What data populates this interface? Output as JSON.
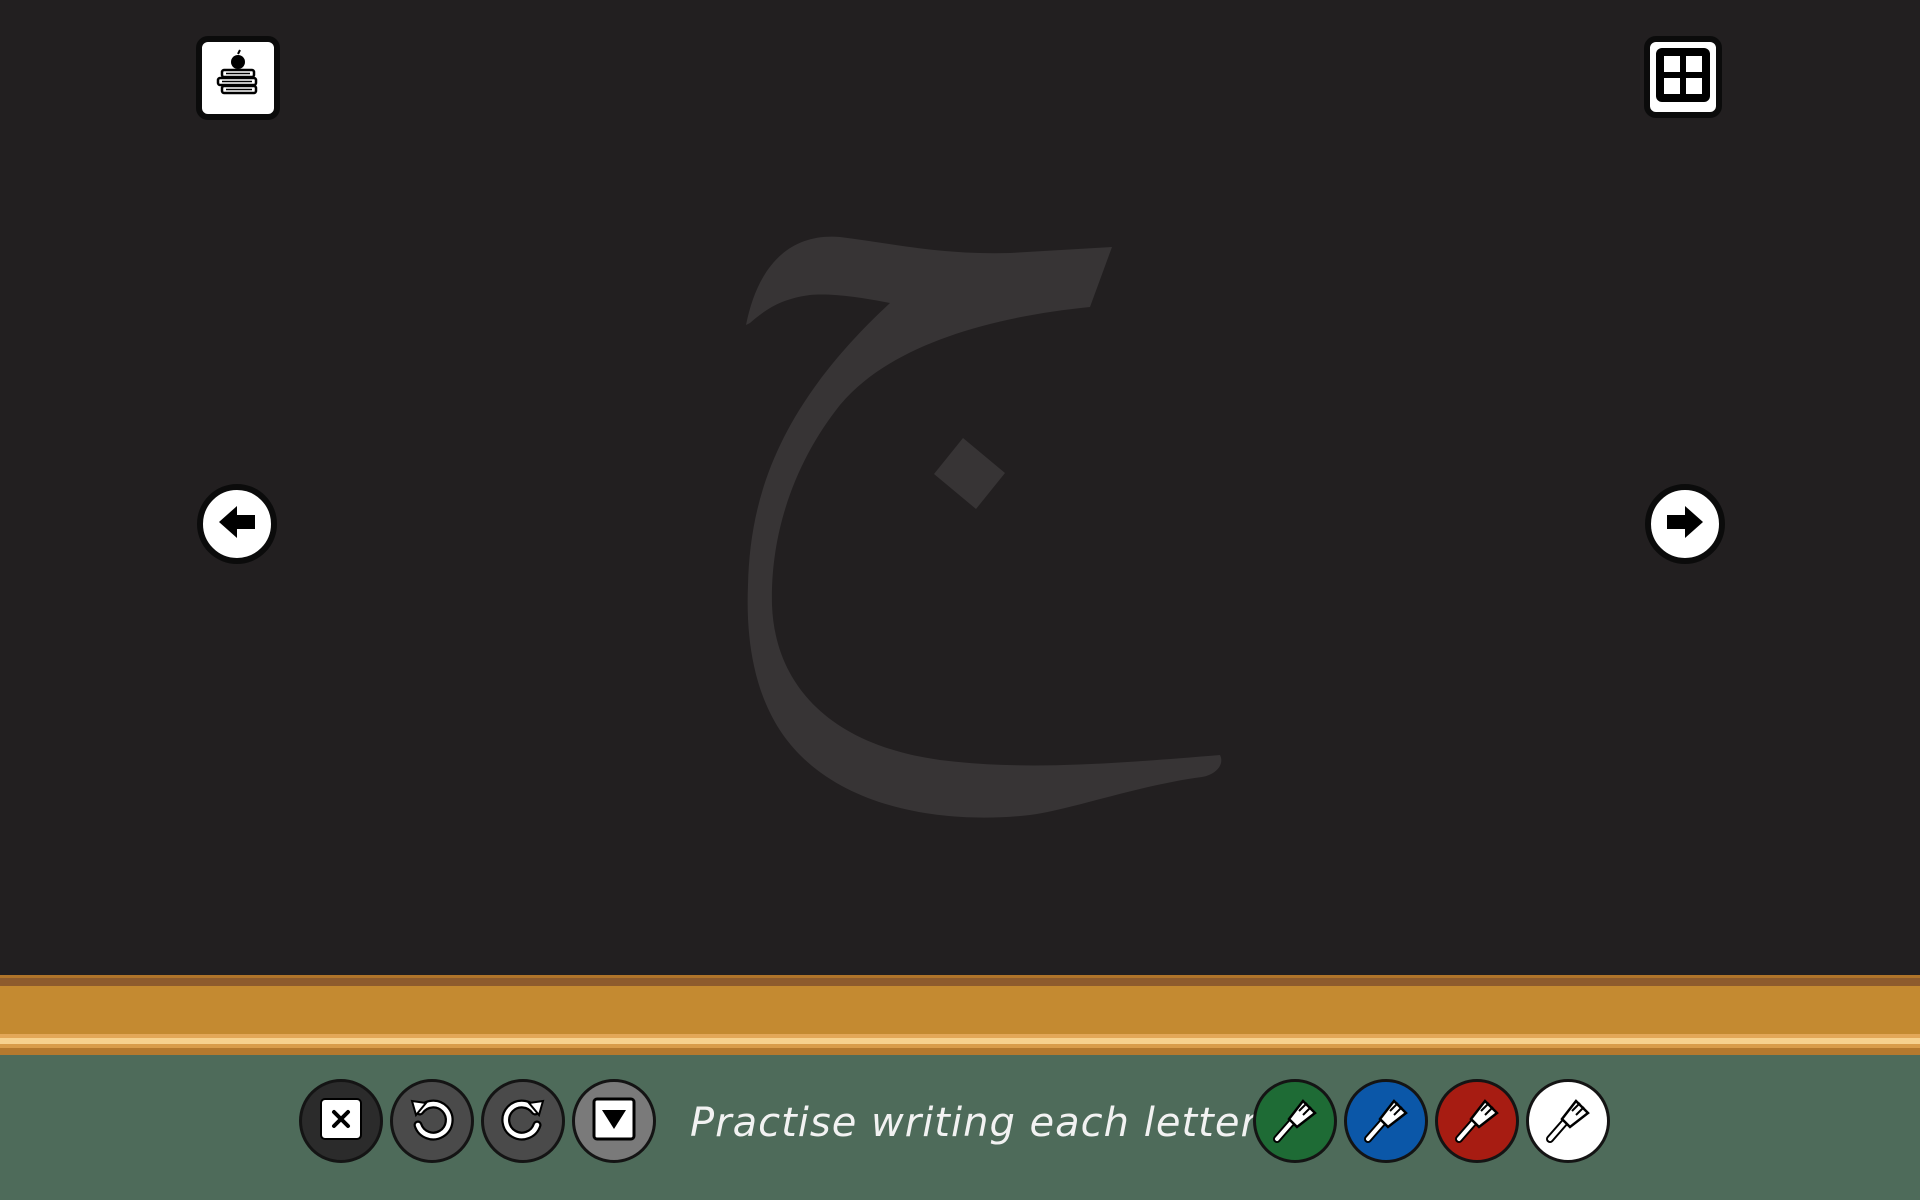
{
  "top_left": {
    "icon": "books-apple-icon",
    "label": "Resources"
  },
  "top_right": {
    "icon": "grid-icon",
    "label": "Letter grid"
  },
  "nav": {
    "prev_icon": "arrow-left-icon",
    "next_icon": "arrow-right-icon"
  },
  "guide": {
    "letter": "ج",
    "color": "#373435"
  },
  "toolbar": {
    "instruction": "Practise writing each letter...",
    "tools": [
      {
        "name": "clear",
        "icon": "close-icon",
        "color": "#2b2b2b"
      },
      {
        "name": "undo",
        "icon": "undo-icon",
        "color": "#4a4a4a"
      },
      {
        "name": "redo",
        "icon": "redo-icon",
        "color": "#4a4a4a"
      },
      {
        "name": "collapse",
        "icon": "chevron-down-icon",
        "color": "#7a7a7a"
      }
    ],
    "brushes": [
      {
        "name": "green",
        "color": "#1e6b35"
      },
      {
        "name": "blue",
        "color": "#0b57a8"
      },
      {
        "name": "red",
        "color": "#a71c12"
      },
      {
        "name": "white",
        "color": "#ffffff"
      }
    ]
  },
  "colors": {
    "board": "#221f20",
    "ledge": "#c48a31",
    "toolbar": "#4e6b5a"
  }
}
